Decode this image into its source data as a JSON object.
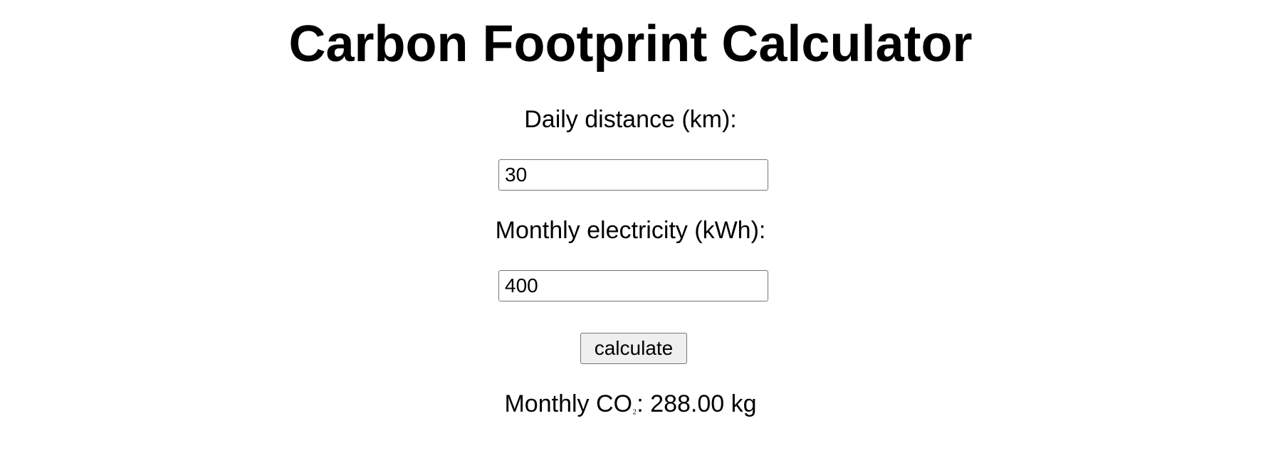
{
  "page": {
    "title": "Carbon Footprint Calculator"
  },
  "form": {
    "distance_label": "Daily distance (km):",
    "distance_value": "30",
    "electricity_label": "Monthly electricity (kWh):",
    "electricity_value": "400",
    "calculate_label": "calculate"
  },
  "result": {
    "prefix": "Monthly CO",
    "subscript": "₂",
    "suffix": ": 288.00 kg"
  }
}
